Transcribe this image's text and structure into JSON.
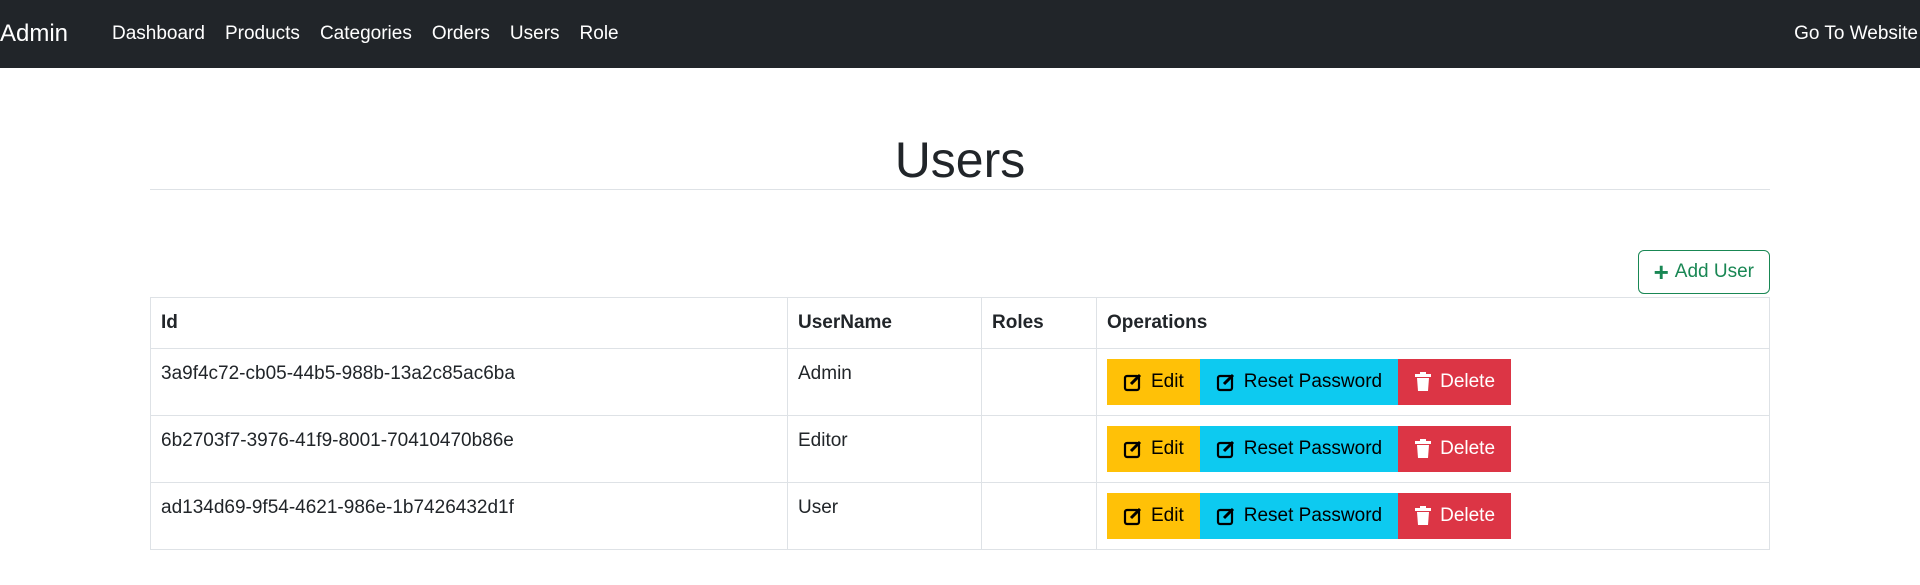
{
  "nav": {
    "brand": "Admin",
    "links": [
      "Dashboard",
      "Products",
      "Categories",
      "Orders",
      "Users",
      "Role"
    ],
    "right_link": "Go To Website"
  },
  "page": {
    "title": "Users",
    "add_button_label": "Add User"
  },
  "table": {
    "headers": [
      "Id",
      "UserName",
      "Roles",
      "Operations"
    ],
    "rows": [
      {
        "id": "3a9f4c72-cb05-44b5-988b-13a2c85ac6ba",
        "username": "Admin",
        "roles": ""
      },
      {
        "id": "6b2703f7-3976-41f9-8001-70410470b86e",
        "username": "Editor",
        "roles": ""
      },
      {
        "id": "ad134d69-9f54-4621-986e-1b7426432d1f",
        "username": "User",
        "roles": ""
      }
    ],
    "operations": {
      "edit": "Edit",
      "reset": "Reset Password",
      "delete": "Delete"
    }
  },
  "icons": {
    "add": "plus-icon",
    "edit": "edit-icon",
    "reset": "edit-icon",
    "delete": "trash-icon"
  },
  "colors": {
    "navbar": "#212529",
    "edit": "#ffc107",
    "reset": "#0dcaf0",
    "delete": "#dc3545",
    "add": "#198754"
  }
}
